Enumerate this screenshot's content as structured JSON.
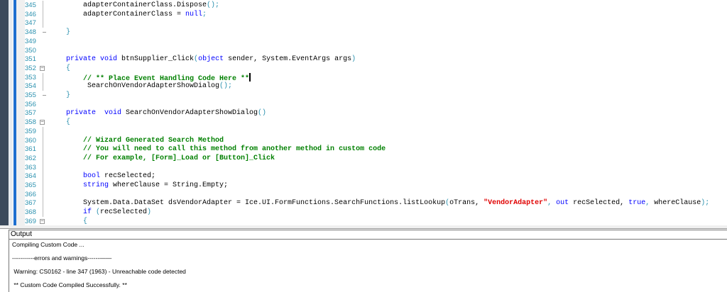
{
  "editor": {
    "caret_line": 353,
    "lines": [
      {
        "n": 345,
        "fold": "line",
        "tokens": [
          [
            "pl",
            "    adapterContainerClass.Dispose"
          ],
          [
            "pu",
            "();"
          ]
        ]
      },
      {
        "n": 346,
        "fold": "line",
        "tokens": [
          [
            "pl",
            "    adapterContainerClass = "
          ],
          [
            "kw",
            "null"
          ],
          [
            "pu",
            ";"
          ]
        ]
      },
      {
        "n": 347,
        "fold": "line",
        "tokens": []
      },
      {
        "n": 348,
        "fold": "end",
        "tokens": [
          [
            "pu",
            "}"
          ]
        ]
      },
      {
        "n": 349,
        "fold": "",
        "tokens": []
      },
      {
        "n": 350,
        "fold": "",
        "tokens": []
      },
      {
        "n": 351,
        "fold": "",
        "tokens": [
          [
            "kw",
            "private void "
          ],
          [
            "pl",
            "btnSupplier_Click"
          ],
          [
            "pu",
            "("
          ],
          [
            "kw",
            "object "
          ],
          [
            "pl",
            "sender, System.EventArgs args"
          ],
          [
            "pu",
            ")"
          ]
        ]
      },
      {
        "n": 352,
        "fold": "box",
        "tokens": [
          [
            "pu",
            "{"
          ]
        ]
      },
      {
        "n": 353,
        "fold": "line",
        "tokens": [
          [
            "cm",
            "    // ** Place Event Handling Code Here **"
          ]
        ]
      },
      {
        "n": 354,
        "fold": "line",
        "tokens": [
          [
            "pl",
            "     SearchOnVendorAdapterShowDialog"
          ],
          [
            "pu",
            "();"
          ]
        ]
      },
      {
        "n": 355,
        "fold": "end",
        "tokens": [
          [
            "pu",
            "}"
          ]
        ]
      },
      {
        "n": 356,
        "fold": "",
        "tokens": []
      },
      {
        "n": 357,
        "fold": "",
        "tokens": [
          [
            "kw",
            "private  void "
          ],
          [
            "pl",
            "SearchOnVendorAdapterShowDialog"
          ],
          [
            "pu",
            "()"
          ]
        ]
      },
      {
        "n": 358,
        "fold": "box",
        "tokens": [
          [
            "pu",
            "{"
          ]
        ]
      },
      {
        "n": 359,
        "fold": "line",
        "tokens": []
      },
      {
        "n": 360,
        "fold": "line",
        "tokens": [
          [
            "cm",
            "    // Wizard Generated Search Method"
          ]
        ]
      },
      {
        "n": 361,
        "fold": "line",
        "tokens": [
          [
            "cm",
            "    // You will need to call this method from another method in custom code"
          ]
        ]
      },
      {
        "n": 362,
        "fold": "line",
        "tokens": [
          [
            "cm",
            "    // For example, [Form]_Load or [Button]_Click"
          ]
        ]
      },
      {
        "n": 363,
        "fold": "line",
        "tokens": []
      },
      {
        "n": 364,
        "fold": "line",
        "tokens": [
          [
            "kw",
            "    bool "
          ],
          [
            "pl",
            "recSelected;"
          ]
        ]
      },
      {
        "n": 365,
        "fold": "line",
        "tokens": [
          [
            "kw",
            "    string "
          ],
          [
            "pl",
            "whereClause = String.Empty;"
          ]
        ]
      },
      {
        "n": 366,
        "fold": "line",
        "tokens": []
      },
      {
        "n": 367,
        "fold": "line",
        "tokens": [
          [
            "pl",
            "    System.Data.DataSet dsVendorAdapter = Ice.UI.FormFunctions.SearchFunctions.listLookup"
          ],
          [
            "pu",
            "("
          ],
          [
            "pl",
            "oTrans, "
          ],
          [
            "str",
            "\"VendorAdapter\""
          ],
          [
            "pu",
            ", "
          ],
          [
            "kw",
            "out "
          ],
          [
            "pl",
            "recSelected, "
          ],
          [
            "kw",
            "true"
          ],
          [
            "pu",
            ", "
          ],
          [
            "pl",
            "whereClause"
          ],
          [
            "pu",
            ");"
          ]
        ]
      },
      {
        "n": 368,
        "fold": "line",
        "tokens": [
          [
            "kw",
            "    if "
          ],
          [
            "pu",
            "("
          ],
          [
            "pl",
            "recSelected"
          ],
          [
            "pu",
            ")"
          ]
        ]
      },
      {
        "n": 369,
        "fold": "box",
        "tokens": [
          [
            "pu",
            "    {"
          ]
        ]
      }
    ]
  },
  "output": {
    "title": "Output",
    "lines": [
      "Compiling Custom Code ...",
      "-----------errors and warnings------——",
      " Warning: CS0162 - line 347 (1963) - Unreachable code detected",
      " ** Custom Code Compiled Successfully. **"
    ]
  }
}
